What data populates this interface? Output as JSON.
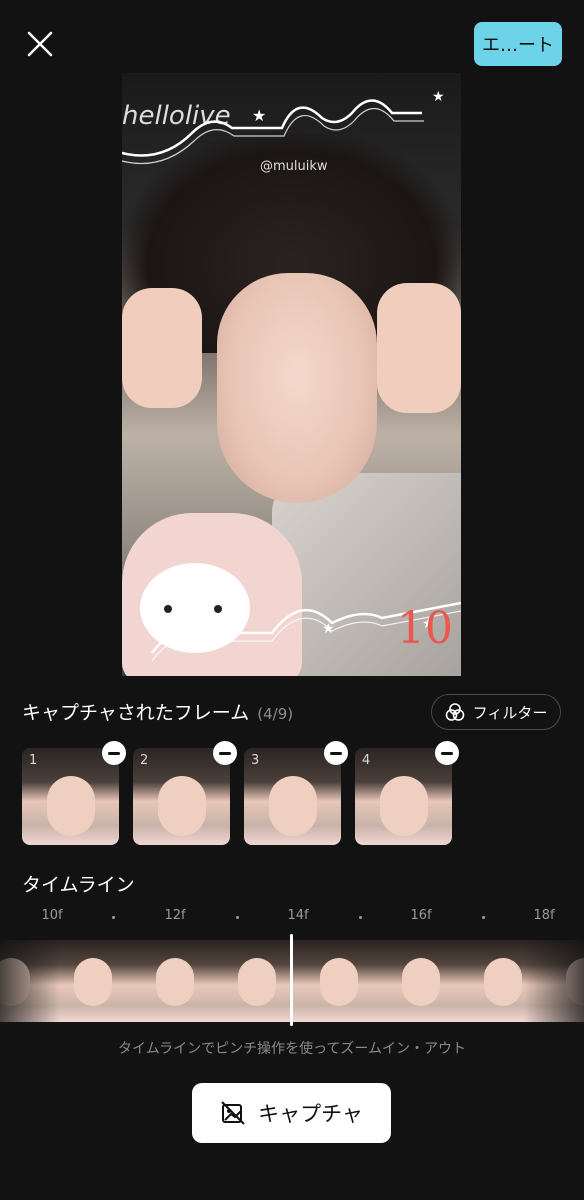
{
  "header": {
    "close_icon": "close-icon",
    "next_label": "エ…ート"
  },
  "preview": {
    "watermark": "hellolive",
    "handle": "@muluikw",
    "badge": "10"
  },
  "frames": {
    "title": "キャプチャされたフレーム",
    "count": "(4/9)",
    "filter_label": "フィルター",
    "items": [
      {
        "number": "1"
      },
      {
        "number": "2"
      },
      {
        "number": "3"
      },
      {
        "number": "4"
      }
    ]
  },
  "timeline": {
    "title": "タイムライン",
    "ticks": [
      "10f",
      "12f",
      "14f",
      "16f",
      "18f"
    ],
    "hint": "タイムラインでピンチ操作を使ってズームイン・アウト"
  },
  "capture": {
    "label": "キャプチャ",
    "icon": "capture-image-icon"
  },
  "colors": {
    "background": "#121212",
    "accent": "#6dd3e8"
  }
}
